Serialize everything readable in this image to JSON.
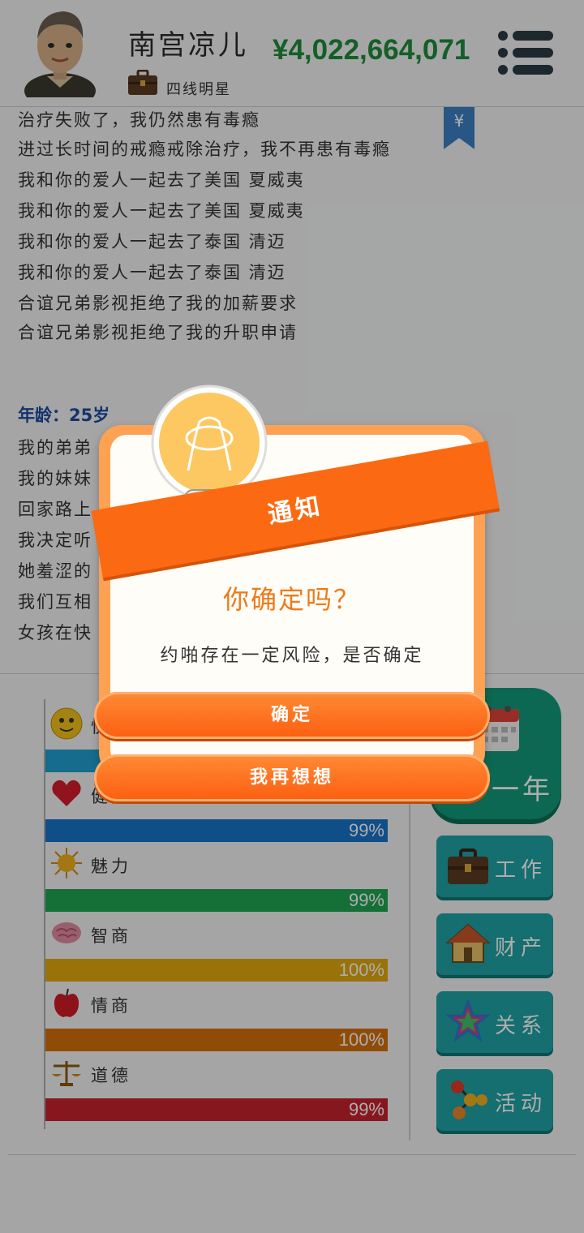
{
  "header": {
    "player_name": "南宫凉儿",
    "job_title": "四线明星",
    "money": "¥4,022,664,071"
  },
  "log": {
    "lines_top": [
      "治疗失败了，我仍然患有毒瘾",
      "进过长时间的戒瘾戒除治疗，我不再患有毒瘾",
      "我和你的爱人一起去了美国 夏威夷",
      "我和你的爱人一起去了美国 夏威夷",
      "我和你的爱人一起去了泰国 清迈",
      "我和你的爱人一起去了泰国 清迈",
      "合谊兄弟影视拒绝了我的加薪要求",
      "合谊兄弟影视拒绝了我的升职申请"
    ],
    "age_label": "年龄：25岁",
    "lines_bottom": [
      "我的弟弟",
      "我的妹妹",
      "回家路上",
      "我决定听",
      "她羞涩的",
      "我们互相",
      "女孩在快"
    ]
  },
  "stats": [
    {
      "label": "快乐",
      "value": 100,
      "pct": "",
      "color": "#1f9fd0",
      "icon": "smiley-icon"
    },
    {
      "label": "健康",
      "value": 99,
      "pct": "99%",
      "color": "#1873c7",
      "icon": "heart-icon"
    },
    {
      "label": "魅力",
      "value": 99,
      "pct": "99%",
      "color": "#1fa653",
      "icon": "sun-icon"
    },
    {
      "label": "智商",
      "value": 100,
      "pct": "100%",
      "color": "#e3a80f",
      "icon": "brain-icon"
    },
    {
      "label": "情商",
      "value": 100,
      "pct": "100%",
      "color": "#d4700b",
      "icon": "apple-icon"
    },
    {
      "label": "道德",
      "value": 99,
      "pct": "99%",
      "color": "#c7232e",
      "icon": "scales-icon"
    }
  ],
  "actions": {
    "next_year": "一年",
    "work": "工作",
    "assets": "财产",
    "relations": "关系",
    "activities": "活动"
  },
  "modal": {
    "ribbon": "通知",
    "title": "你确定吗？",
    "message": "约啪存在一定风险，是否确定",
    "confirm": "确定",
    "cancel": "我再想想"
  },
  "colors": {
    "money": "#1e8c3a",
    "age": "#1b4aa0",
    "modal_orange": "#fb6a12",
    "next_year_green": "#139a79",
    "side_teal": "#1fa3a4"
  }
}
